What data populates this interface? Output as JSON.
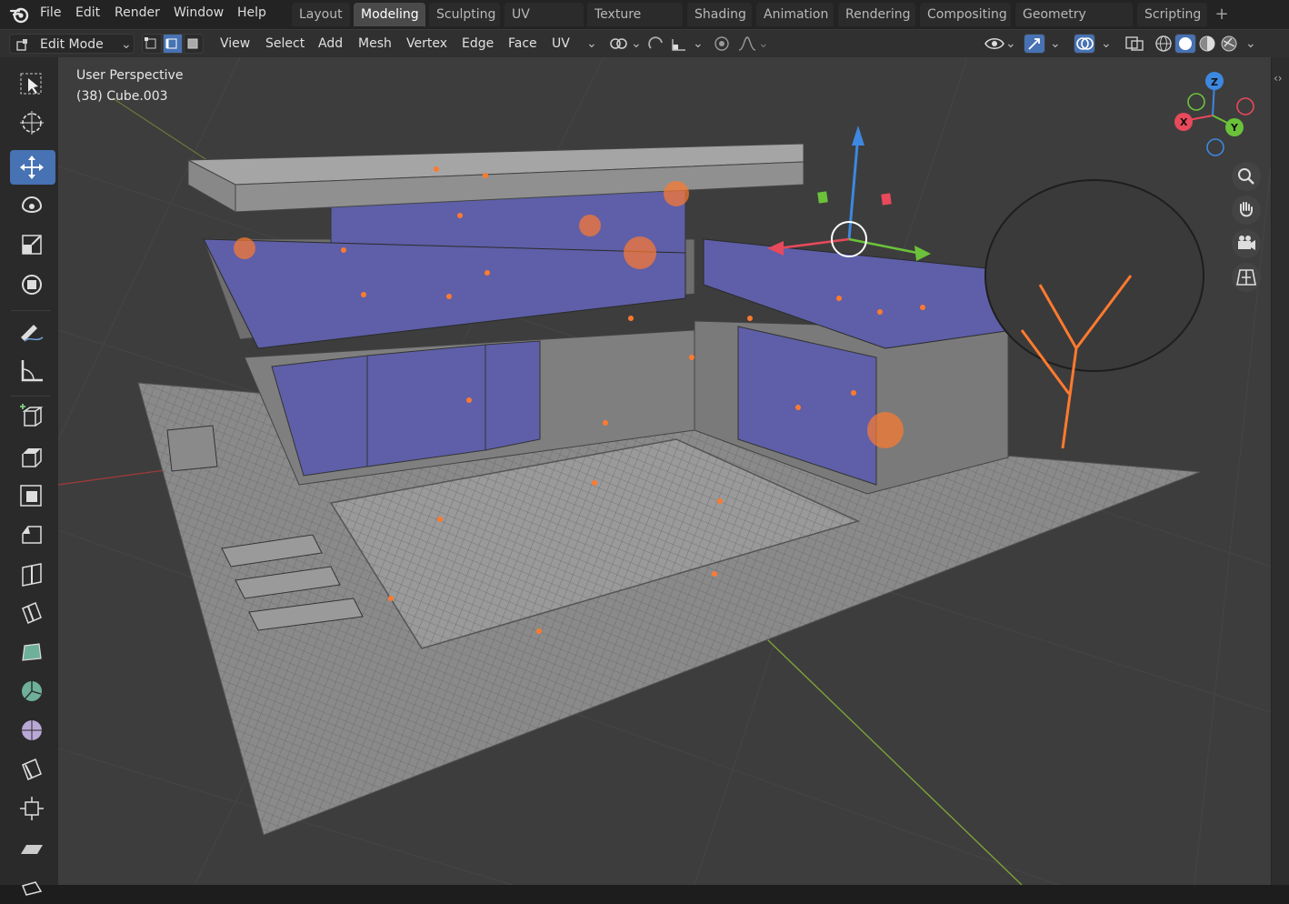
{
  "menus": [
    "File",
    "Edit",
    "Render",
    "Window",
    "Help"
  ],
  "workspaces": [
    "Layout",
    "Modeling",
    "Sculpting",
    "UV Editing",
    "Texture Paint",
    "Shading",
    "Animation",
    "Rendering",
    "Compositing",
    "Geometry Nodes",
    "Scripting"
  ],
  "active_workspace": "Modeling",
  "header": {
    "mode": "Edit Mode",
    "view": "View",
    "select": "Select",
    "add": "Add",
    "mesh": "Mesh",
    "vertex": "Vertex",
    "edge": "Edge",
    "face": "Face",
    "uv": "UV"
  },
  "viewport": {
    "perspective": "User Perspective",
    "object": "(38) Cube.003"
  },
  "gizmo": {
    "x": "X",
    "y": "Y",
    "z": "Z"
  },
  "colors": {
    "accent": "#4772b3",
    "selected": "#ff7a2e",
    "glass": "#5e5fa8"
  }
}
